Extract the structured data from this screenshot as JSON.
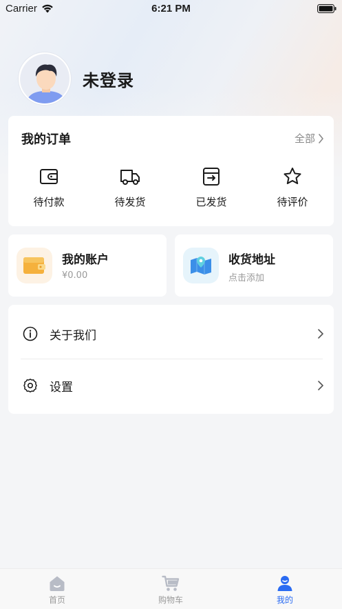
{
  "status": {
    "carrier": "Carrier",
    "time": "6:21 PM"
  },
  "profile": {
    "name": "未登录"
  },
  "orders": {
    "title": "我的订单",
    "all_label": "全部",
    "items": [
      {
        "label": "待付款",
        "icon": "wallet-icon"
      },
      {
        "label": "待发货",
        "icon": "truck-icon"
      },
      {
        "label": "已发货",
        "icon": "shipped-box-icon"
      },
      {
        "label": "待评价",
        "icon": "star-icon"
      }
    ]
  },
  "account": {
    "title": "我的账户",
    "balance": "¥0.00",
    "icon": "wallet-orange-icon"
  },
  "address": {
    "title": "收货地址",
    "subtitle": "点击添加",
    "icon": "map-pin-icon"
  },
  "menu": [
    {
      "label": "关于我们",
      "icon": "info-icon"
    },
    {
      "label": "设置",
      "icon": "settings-icon"
    }
  ],
  "tabs": [
    {
      "label": "首页",
      "icon": "home-icon",
      "active": false
    },
    {
      "label": "购物车",
      "icon": "cart-icon",
      "active": false
    },
    {
      "label": "我的",
      "icon": "user-icon",
      "active": true
    }
  ],
  "colors": {
    "accent": "#2a6bf2",
    "muted": "#999999",
    "account_icon_bg": "#fdf2e4",
    "address_icon_bg": "#e6f4fb"
  }
}
